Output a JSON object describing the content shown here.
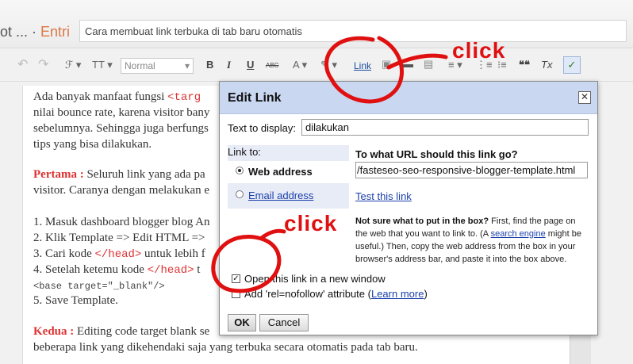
{
  "header": {
    "breadcrumb_prefix": "ot ... · ",
    "breadcrumb_entri": "Entri",
    "post_title": "Cara membuat link terbuka di tab baru otomatis"
  },
  "toolbar": {
    "undo": "↶",
    "redo": "↷",
    "font": "ℱ ▾",
    "size": "TT ▾",
    "format_value": "Normal",
    "format_caret": "▾",
    "bold": "B",
    "italic": "I",
    "underline": "U",
    "strike": "ABC",
    "text_color": "A ▾",
    "highlight": "✎ ▾",
    "link": "Link",
    "image": "▣",
    "video": "▬",
    "break": "▤",
    "align": "≡ ▾",
    "numbered_list": "⋮≡",
    "bullet_list": "⁝≡",
    "quote": "❝❝",
    "clear": "Tx",
    "spell": "✓"
  },
  "annotations": {
    "click_top": "click",
    "click_bottom": "click"
  },
  "editor": {
    "p1_a": "Ada banyak manfaat fungsi ",
    "p1_code": "<targ",
    "p1_b": "nilai bounce rate, karena visitor bany",
    "p1_c": "sebelumnya. Sehingga juga berfungs",
    "p1_d": "tips yang bisa dilakukan.",
    "p2_label": "Pertama :",
    "p2_a": " Seluruh link yang ada pa",
    "p2_b": "visitor. Caranya dengan melakukan e",
    "step1": "1. Masuk dashboard blogger blog An",
    "step2": "2. Klik Template => Edit HTML =>",
    "step3_a": "3. Cari kode ",
    "step3_code": "</head>",
    "step3_b": " untuk lebih f",
    "step4_a": "4. Setelah ketemu kode ",
    "step4_code": "</head>",
    "step4_b": " t",
    "step4_code2": "<base target=\"_blank\"/>",
    "step5": "5. Save Template.",
    "p3_label": "Kedua :",
    "p3_a": " Editing code target blank se",
    "p3_b": "beberapa link yang dikehendaki saja yang terbuka secara otomatis pada tab baru."
  },
  "dialog": {
    "title": "Edit Link",
    "close": "✕",
    "text_to_display_label": "Text to display:",
    "text_to_display_value": "dilakukan",
    "link_to_label": "Link to:",
    "opt_web": "Web address",
    "opt_email": "Email address",
    "url_heading": "To what URL should this link go?",
    "url_value": "/fasteseo-seo-responsive-blogger-template.html",
    "test_link": "Test this link",
    "help_bold": "Not sure what to put in the box?",
    "help_a": " First, find the page on the web that you want to link to. (A ",
    "help_link": "search engine",
    "help_b": " might be useful.) Then, copy the web address from the box in your browser's address bar, and paste it into the box above.",
    "cb_new_window_mark": "✓",
    "cb_new_window_label": "Open this link in a new window",
    "cb_nofollow_label_a": "Add 'rel=nofollow' attribute (",
    "cb_nofollow_link": "Learn more",
    "cb_nofollow_label_b": ")",
    "ok": "OK",
    "cancel": "Cancel"
  },
  "colors": {
    "accent_red": "#e01010",
    "dialog_header": "#c9d7f1",
    "link_blue": "#1a3faa"
  }
}
